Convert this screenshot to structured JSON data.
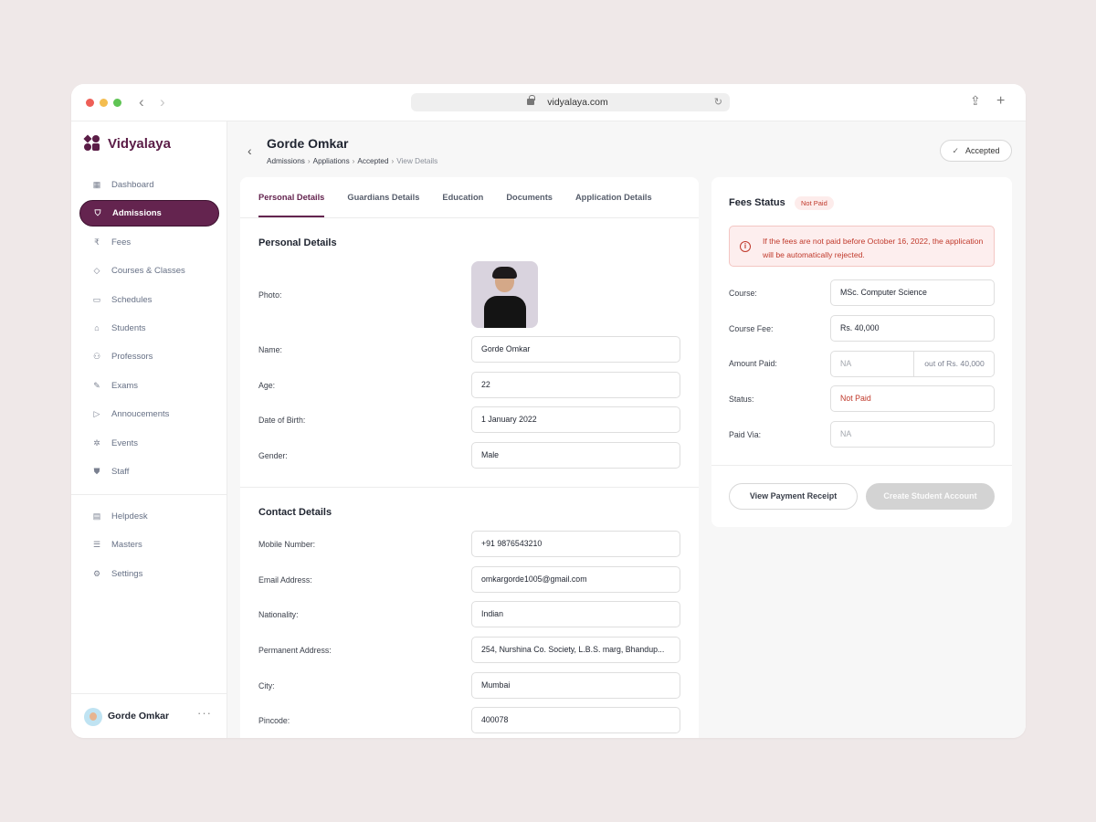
{
  "browser": {
    "url": "vidyalaya.com"
  },
  "brand": {
    "name": "Vidyalaya",
    "color": "#5b1d47"
  },
  "sidebar": {
    "items": [
      {
        "label": "Dashboard",
        "icon": "grid-icon"
      },
      {
        "label": "Admissions",
        "icon": "shield-icon",
        "active": true
      },
      {
        "label": "Fees",
        "icon": "rupee-icon"
      },
      {
        "label": "Courses & Classes",
        "icon": "shapes-icon"
      },
      {
        "label": "Schedules",
        "icon": "calendar-icon"
      },
      {
        "label": "Students",
        "icon": "graduation-cap-icon"
      },
      {
        "label": "Professors",
        "icon": "users-icon"
      },
      {
        "label": "Exams",
        "icon": "pencil-icon"
      },
      {
        "label": "Annoucements",
        "icon": "tag-icon"
      },
      {
        "label": "Events",
        "icon": "party-icon"
      },
      {
        "label": "Staff",
        "icon": "shield-check-icon"
      }
    ],
    "secondary": [
      {
        "label": "Helpdesk",
        "icon": "chat-icon"
      },
      {
        "label": "Masters",
        "icon": "database-icon"
      },
      {
        "label": "Settings",
        "icon": "gear-icon"
      }
    ],
    "user": {
      "name": "Gorde Omkar"
    }
  },
  "header": {
    "title": "Gorde Omkar",
    "breadcrumbs": [
      "Admissions",
      "Appliations",
      "Accepted",
      "View Details"
    ],
    "status": "Accepted"
  },
  "tabs": [
    "Personal Details",
    "Guardians Details",
    "Education",
    "Documents",
    "Application Details"
  ],
  "personal": {
    "title": "Personal Details",
    "photo_label": "Photo:",
    "name_label": "Name:",
    "name": "Gorde Omkar",
    "age_label": "Age:",
    "age": "22",
    "dob_label": "Date of Birth:",
    "dob": "1 January 2022",
    "gender_label": "Gender:",
    "gender": "Male"
  },
  "contact": {
    "title": "Contact Details",
    "mobile_label": "Mobile Number:",
    "mobile": "+91 9876543210",
    "email_label": "Email Address:",
    "email": "omkargorde1005@gmail.com",
    "nationality_label": "Nationality:",
    "nationality": "Indian",
    "address_label": "Permanent Address:",
    "address": "254, Nurshina Co. Society, L.B.S. marg, Bhandup...",
    "city_label": "City:",
    "city": "Mumbai",
    "pincode_label": "Pincode:",
    "pincode": "400078"
  },
  "fees": {
    "title": "Fees Status",
    "badge": "Not Paid",
    "alert": "If the fees are not paid before October 16, 2022, the application will be automatically rejected.",
    "course_label": "Course:",
    "course": "MSc. Computer Science",
    "fee_label": "Course Fee:",
    "fee": "Rs. 40,000",
    "paid_label": "Amount Paid:",
    "paid_placeholder": "NA",
    "paid_suffix": "out of Rs. 40,000",
    "status_label": "Status:",
    "status": "Not Paid",
    "via_label": "Paid Via:",
    "via_placeholder": "NA",
    "receipt_button": "View Payment Receipt",
    "create_button": "Create Student Account"
  },
  "colors": {
    "accent": "#64244f",
    "danger": "#c0392b"
  }
}
